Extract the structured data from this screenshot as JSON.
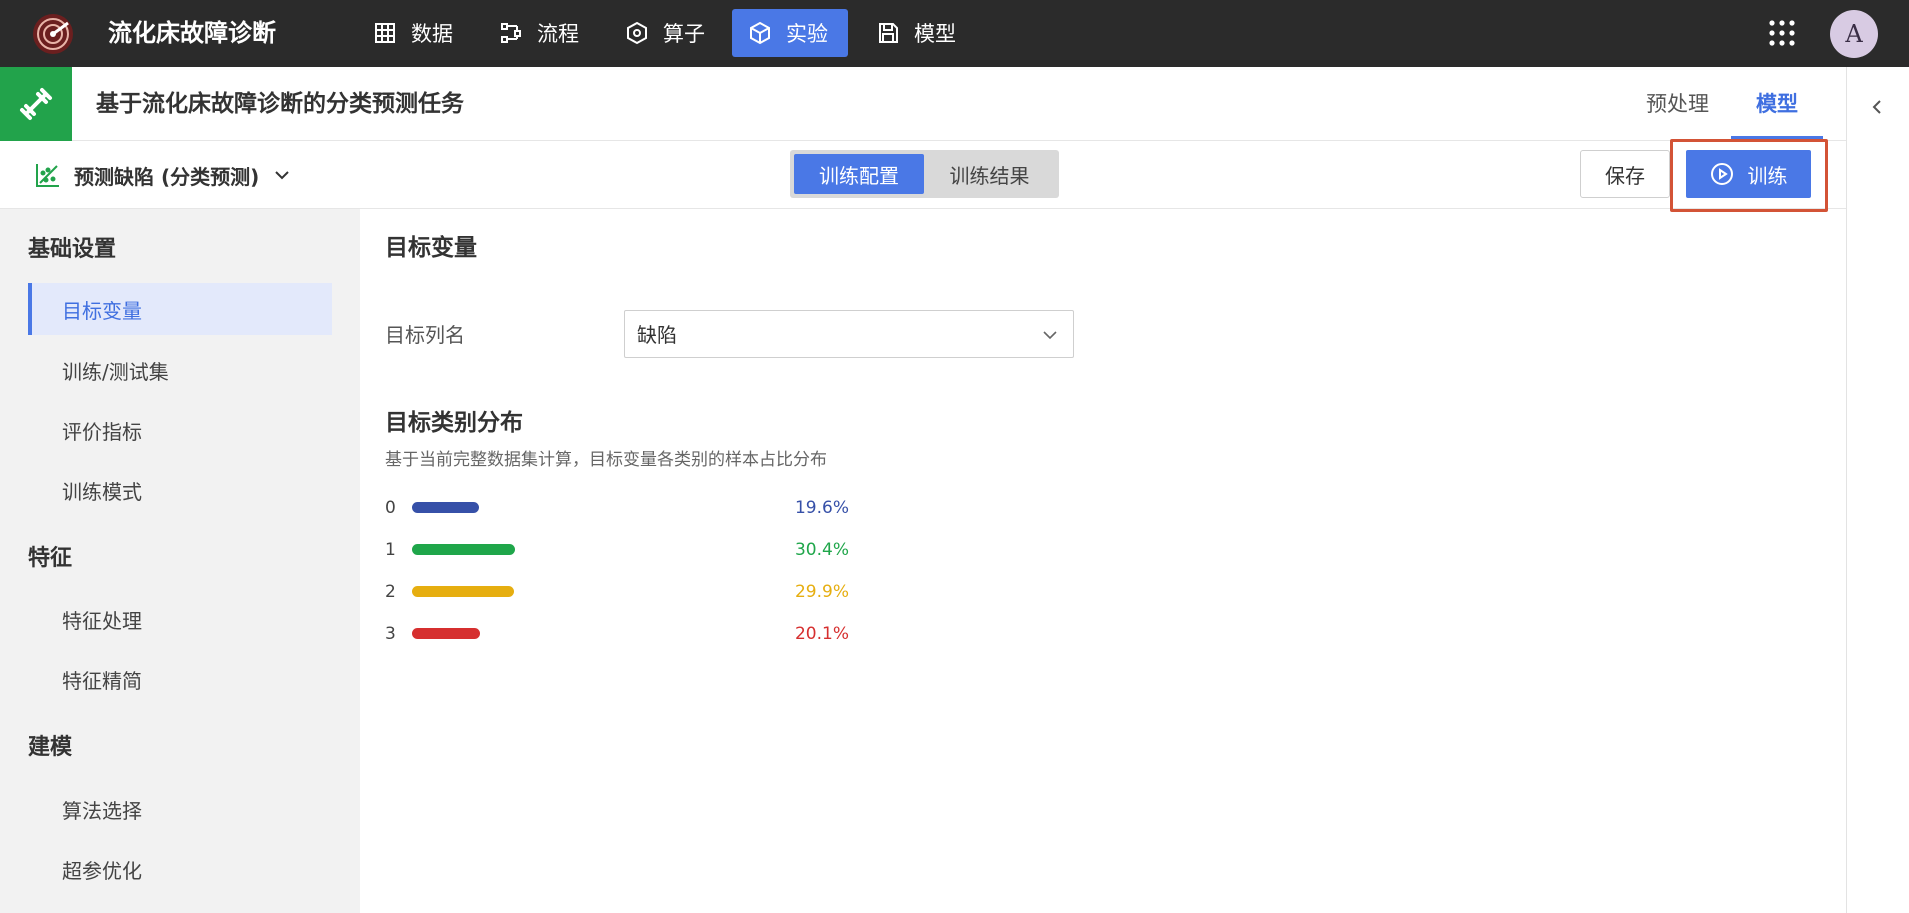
{
  "app": {
    "title": "流化床故障诊断"
  },
  "nav": {
    "items": [
      {
        "label": "数据",
        "icon": "table-icon"
      },
      {
        "label": "流程",
        "icon": "flow-icon"
      },
      {
        "label": "算子",
        "icon": "hexagon-icon"
      },
      {
        "label": "实验",
        "icon": "cube-icon",
        "active": true
      },
      {
        "label": "模型",
        "icon": "save-icon"
      }
    ]
  },
  "user": {
    "avatar_letter": "A"
  },
  "header": {
    "task_title": "基于流化床故障诊断的分类预测任务",
    "tabs": [
      {
        "label": "预处理"
      },
      {
        "label": "模型",
        "active": true
      }
    ]
  },
  "toolbar": {
    "model_select": "预测缺陷 (分类预测)",
    "segments": [
      {
        "label": "训练配置",
        "active": true
      },
      {
        "label": "训练结果"
      }
    ],
    "save_label": "保存",
    "train_label": "训练"
  },
  "sidebar": {
    "groups": [
      {
        "title": "基础设置",
        "items": [
          "目标变量",
          "训练/测试集",
          "评价指标",
          "训练模式"
        ]
      },
      {
        "title": "特征",
        "items": [
          "特征处理",
          "特征精简"
        ]
      },
      {
        "title": "建模",
        "items": [
          "算法选择",
          "超参优化"
        ]
      }
    ],
    "active_item": "目标变量"
  },
  "main": {
    "title": "目标变量",
    "target_column_label": "目标列名",
    "target_column_value": "缺陷",
    "distribution_title": "目标类别分布",
    "distribution_desc": "基于当前完整数据集计算，目标变量各类别的样本占比分布",
    "distribution": [
      {
        "class": "0",
        "percent": "19.6%",
        "value": 19.6,
        "color": "#3650a8"
      },
      {
        "class": "1",
        "percent": "30.4%",
        "value": 30.4,
        "color": "#1fa64a"
      },
      {
        "class": "2",
        "percent": "29.9%",
        "value": 29.9,
        "color": "#e6ae10"
      },
      {
        "class": "3",
        "percent": "20.1%",
        "value": 20.1,
        "color": "#d62f2f"
      }
    ]
  },
  "colors": {
    "accent": "#4a78e6",
    "brand_green": "#22a34b",
    "highlight": "#d35336",
    "topbar": "#2b2b2b"
  }
}
